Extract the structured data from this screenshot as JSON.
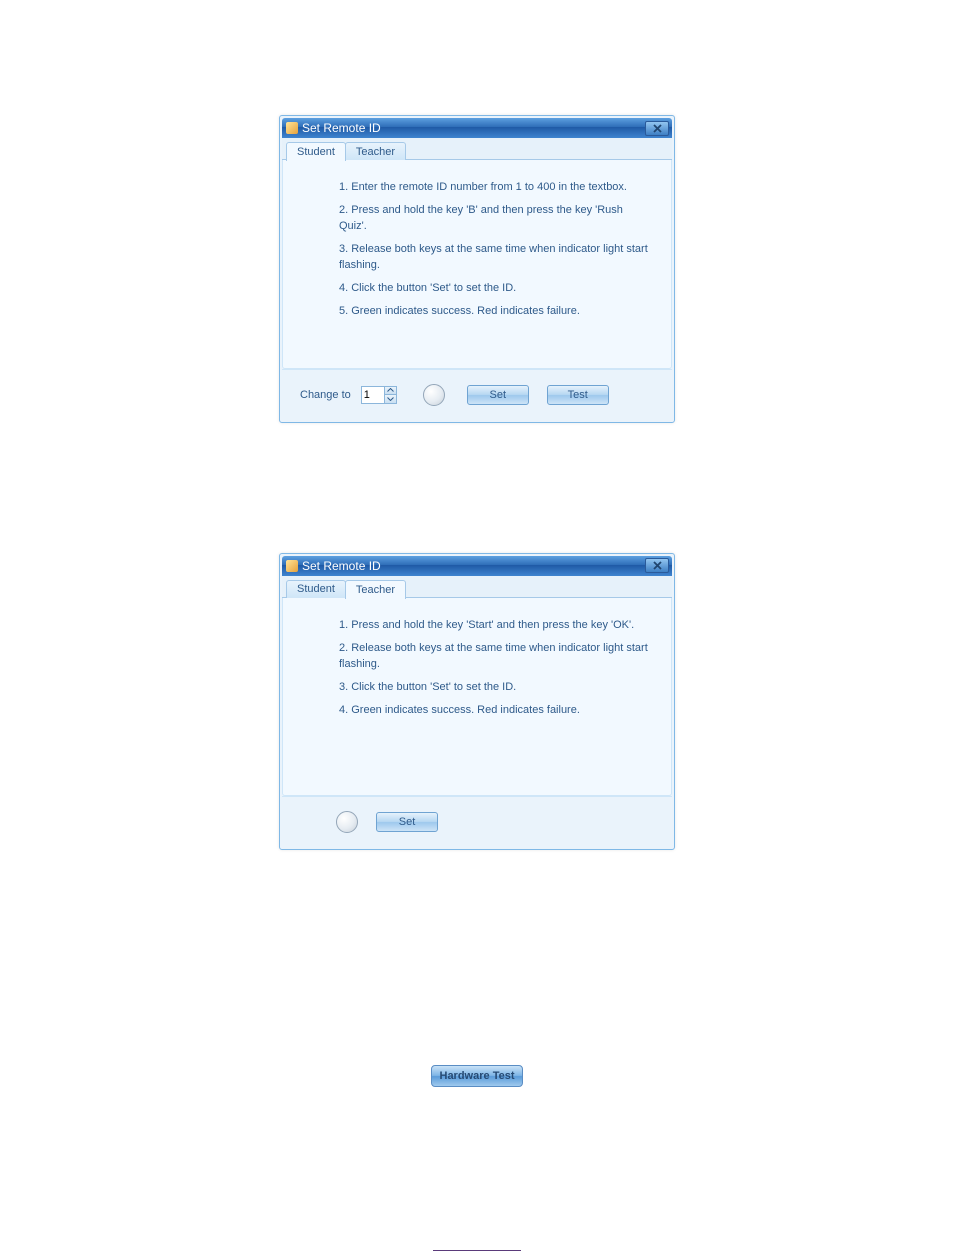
{
  "dialog1": {
    "title": "Set Remote ID",
    "tabs": {
      "student": "Student",
      "teacher": "Teacher",
      "active": "student"
    },
    "steps": [
      "1. Enter the remote ID number from 1 to 400 in the textbox.",
      "2. Press and hold the key 'B' and then press the key 'Rush Quiz'.",
      "3. Release both keys at the same time when indicator light start flashing.",
      "4. Click the button 'Set' to set the ID.",
      "5. Green indicates success. Red indicates failure."
    ],
    "change_to_label": "Change to",
    "change_to_value": "1",
    "set_label": "Set",
    "test_label": "Test"
  },
  "dialog2": {
    "title": "Set Remote ID",
    "tabs": {
      "student": "Student",
      "teacher": "Teacher",
      "active": "teacher"
    },
    "steps": [
      "1. Press and hold the key 'Start' and then press the key 'OK'.",
      "2. Release both keys at the same time when indicator light start flashing.",
      "3. Click the button 'Set' to set the ID.",
      "4. Green indicates success. Red indicates failure."
    ],
    "set_label": "Set"
  },
  "hardware_test_label": "Hardware Test"
}
